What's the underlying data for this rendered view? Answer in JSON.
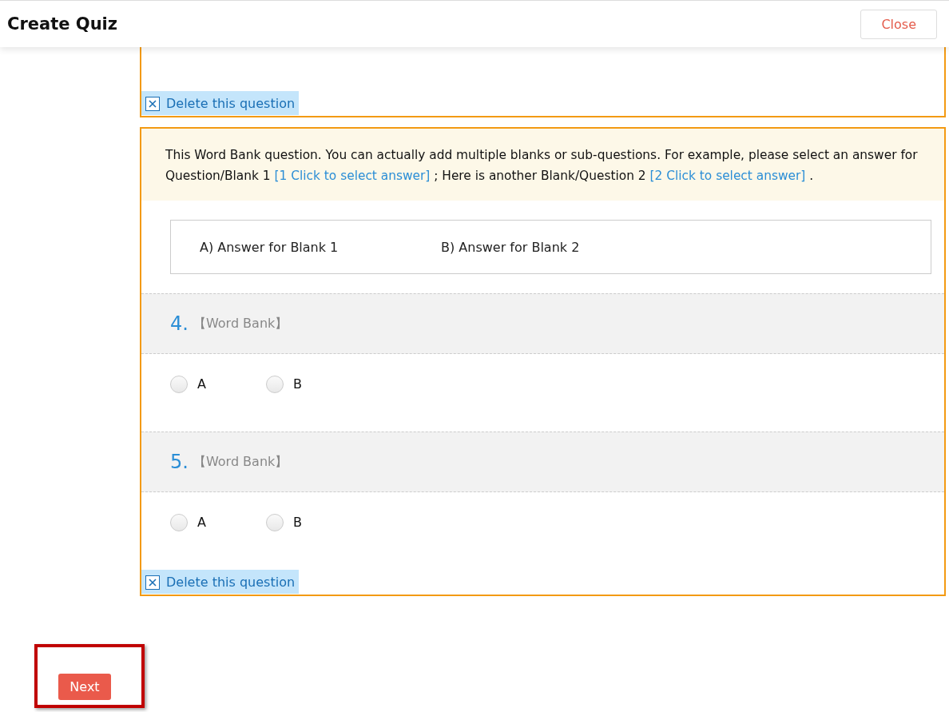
{
  "header": {
    "title": "Create Quiz",
    "close_button": "Close"
  },
  "questions": [
    {
      "kind": "partial",
      "delete_label": "Delete this question"
    },
    {
      "kind": "word_bank",
      "prompt": [
        {
          "kind": "text",
          "text": "This Word Bank question. You can actually add multiple blanks or sub-questions. For example, please select an answer for Question/Blank 1 "
        },
        {
          "kind": "link",
          "text": "[1 Click to select answer]"
        },
        {
          "kind": "text",
          "text": " ; Here is another Blank/Question 2 "
        },
        {
          "kind": "link",
          "text": "[2 Click to select answer]"
        },
        {
          "kind": "text",
          "text": " ."
        }
      ],
      "word_bank": [
        "A) Answer for Blank 1",
        "B) Answer for Blank 2"
      ],
      "sub_questions": [
        {
          "number": "4.",
          "type": "【Word Bank】",
          "options": [
            {
              "label": "A",
              "selected": false
            },
            {
              "label": "B",
              "selected": false
            }
          ]
        },
        {
          "number": "5.",
          "type": "【Word Bank】",
          "options": [
            {
              "label": "A",
              "selected": false
            },
            {
              "label": "B",
              "selected": false
            }
          ]
        }
      ],
      "delete_label": "Delete this question"
    }
  ],
  "next_button": "Next"
}
